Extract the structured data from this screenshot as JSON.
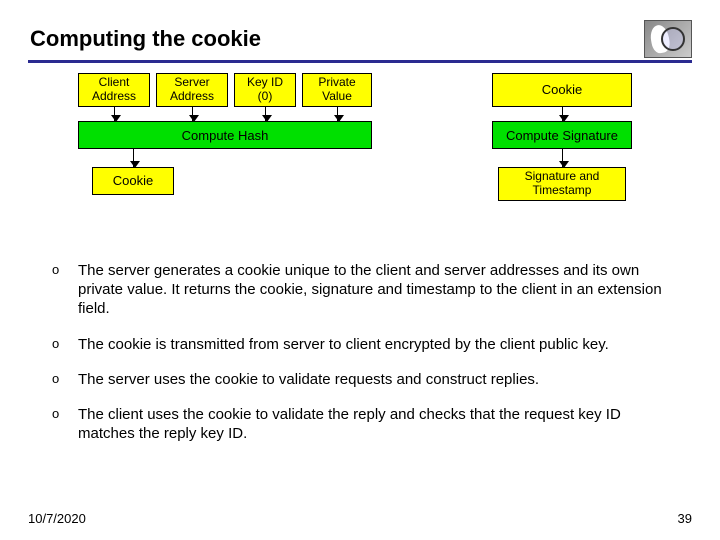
{
  "title": "Computing the cookie",
  "diagram": {
    "inputs": {
      "client": "Client Address",
      "server": "Server Address",
      "keyid": "Key ID (0)",
      "private": "Private Value"
    },
    "cookie_right": "Cookie",
    "compute_hash": "Compute Hash",
    "compute_sig": "Compute Signature",
    "cookie_left": "Cookie",
    "sig_ts": "Signature and Timestamp"
  },
  "bullets": [
    "The server generates a cookie unique to the client and server addresses and its own private value. It returns the cookie, signature and timestamp to the client in an extension field.",
    "The cookie is transmitted from server to client encrypted by the client public key.",
    "The server uses the cookie to validate requests and construct replies.",
    "The client uses the cookie to validate the reply and checks that the request key ID matches the reply key ID."
  ],
  "footer": {
    "date": "10/7/2020",
    "page": "39"
  }
}
